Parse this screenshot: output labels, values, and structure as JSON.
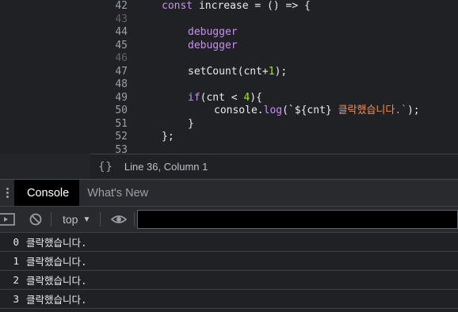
{
  "editor": {
    "line_numbers": [
      "42",
      "43",
      "44",
      "45",
      "46",
      "47",
      "48",
      "49",
      "50",
      "51",
      "52",
      "53"
    ],
    "lines": {
      "l42": {
        "kw": "const",
        "rest": " increase = () => {"
      },
      "l44": {
        "kw": "debugger"
      },
      "l45": {
        "kw": "debugger"
      },
      "l47": {
        "fn": "setCount(cnt+",
        "num": "1",
        "end": ");"
      },
      "l49": {
        "kw": "if",
        "a": "(cnt < ",
        "num": "4",
        "b": "){"
      },
      "l50": {
        "a": "console.",
        "fn": "log",
        "b": "(`${cnt} ",
        "str": "클락했습니다.`",
        "c": ");"
      },
      "l51": {
        "text": "}"
      },
      "l52": {
        "text": "};"
      }
    }
  },
  "statusbar": {
    "braces_icon": "{}",
    "cursor_position": "Line 36, Column 1"
  },
  "drawer": {
    "tabs": [
      {
        "label": "Console",
        "active": true
      },
      {
        "label": "What's New",
        "active": false
      }
    ]
  },
  "toolbar": {
    "context": "top",
    "context_caret": "▼",
    "filter_value": ""
  },
  "console": {
    "messages": [
      {
        "count": "0",
        "text": "클락했습니다."
      },
      {
        "count": "1",
        "text": "클락했습니다."
      },
      {
        "count": "2",
        "text": "클락했습니다."
      },
      {
        "count": "3",
        "text": "클락했습니다."
      }
    ]
  },
  "colors": {
    "keyword": "#c792ea",
    "number": "#a6e22e",
    "string": "#f28b54",
    "background": "#202124"
  },
  "icons": [
    "braces-icon",
    "kebab-menu-icon",
    "sidebar-toggle-icon",
    "clear-console-icon",
    "eye-icon"
  ]
}
